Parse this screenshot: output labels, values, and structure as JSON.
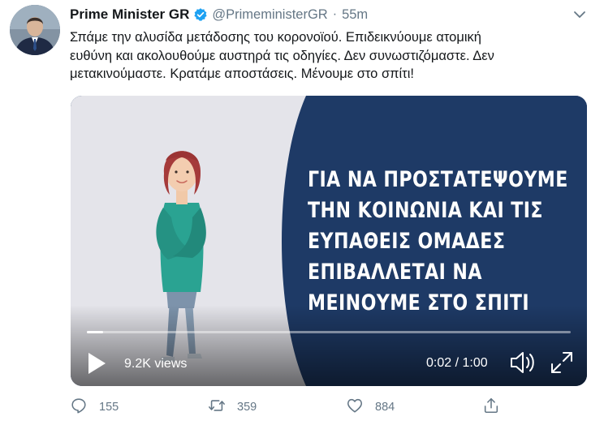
{
  "author": {
    "name": "Prime Minister GR",
    "handle": "@PrimeministerGR",
    "time": "55m",
    "separator": "·",
    "verified": true
  },
  "tweet": {
    "lines": [
      "Σπάμε την αλυσίδα μετάδοσης του κορονοϊού. Επιδεικνύουμε ατομική",
      "ευθύνη και ακολουθούμε αυστηρά τις οδηγίες. Δεν συνωστιζόμαστε. Δεν",
      "μετακινούμαστε. Κρατάμε αποστάσεις. Μένουμε στο σπίτι!"
    ]
  },
  "video": {
    "overlay_lines": [
      "ΓΙΑ ΝΑ ΠΡΟΣΤΑΤΕΨΟΥΜΕ",
      "ΤΗΝ ΚΟΙΝΩΝΙΑ ΚΑΙ ΤΙΣ",
      "ΕΥΠΑΘΕΙΣ ΟΜΑΔΕΣ",
      "ΕΠΙΒΑΛΛΕΤΑΙ ΝΑ",
      "ΜΕΙΝΟΥΜΕ ΣΤΟ ΣΠΙΤΙ"
    ],
    "views": "9.2K views",
    "time_readout": "0:02 / 1:00",
    "progress": 0.033,
    "colors": {
      "panel": "#1e3a66",
      "background": "#e7e7ec"
    }
  },
  "actions": {
    "replies": "155",
    "retweets": "359",
    "likes": "884"
  },
  "icons": {
    "verified": "verified-badge-icon",
    "caret": "chevron-down-icon",
    "reply": "reply-icon",
    "retweet": "retweet-icon",
    "like": "heart-icon",
    "share": "share-icon",
    "play": "play-icon",
    "volume": "volume-icon",
    "fullscreen": "fullscreen-icon"
  },
  "colors": {
    "accent": "#1da1f2",
    "muted": "#657786",
    "text": "#14171a"
  }
}
